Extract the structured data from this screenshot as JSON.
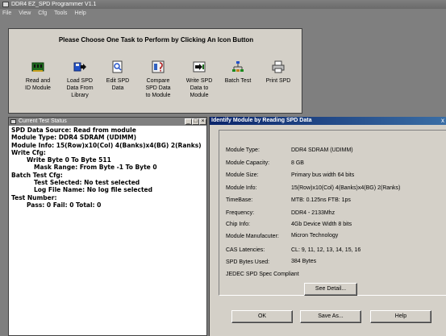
{
  "app": {
    "title": "DDR4 EZ_SPD Programmer V1.1",
    "menu": [
      "File",
      "View",
      "Cfg",
      "Tools",
      "Help"
    ]
  },
  "tasks": {
    "heading": "Please Choose One Task to Perform by Clicking An Icon Button",
    "items": [
      {
        "l1": "Read and",
        "l2": "ID Module",
        "l3": "",
        "icon": "memory-module-icon"
      },
      {
        "l1": "Load SPD",
        "l2": "Data From",
        "l3": "Library",
        "icon": "load-arrow-icon"
      },
      {
        "l1": "Edit SPD",
        "l2": "Data",
        "l3": "",
        "icon": "magnifier-icon"
      },
      {
        "l1": "Compare",
        "l2": "SPD Data",
        "l3": "to Module",
        "icon": "compare-icon"
      },
      {
        "l1": "Write SPD",
        "l2": "Data to",
        "l3": "Module",
        "icon": "write-arrow-icon"
      },
      {
        "l1": "Batch Test",
        "l2": "",
        "l3": "",
        "icon": "batch-network-icon"
      },
      {
        "l1": "Print SPD",
        "l2": "",
        "l3": "",
        "icon": "printer-icon"
      }
    ]
  },
  "status": {
    "title": "Current Test Status",
    "lines": [
      "SPD Data Source:  Read from module",
      "Module Type: DDR4 SDRAM (UDIMM)",
      "Module Info:  15(Row)x10(Col) 4(Banks)x4(BG) 2(Ranks)",
      "Write Cfg:",
      "Write Byte 0 To Byte 511",
      "Mask Range: From Byte -1 To Byte 0",
      "Batch Test Cfg:",
      "Test Selected:     No test selected",
      "Log File Name:    No log file selected",
      "Test Number:",
      "Pass: 0 Fail: 0 Total: 0"
    ]
  },
  "identify": {
    "title": "Identify Module by Reading SPD Data",
    "close": "x",
    "fields": [
      {
        "label": "Module Type:",
        "value": "DDR4 SDRAM (UDIMM)"
      },
      {
        "label": "Module Capacity:",
        "value": "8 GB"
      },
      {
        "label": "Module Size:",
        "value": "Primary bus width 64 bits"
      },
      {
        "label": "Module Info:",
        "value": "15(Row)x10(Col) 4(Banks)x4(BG) 2(Ranks)"
      },
      {
        "label": "TimeBase:",
        "value": "MTB: 0.125ns FTB: 1ps"
      },
      {
        "label": "Frequency:",
        "value": "DDR4 - 2133Mhz"
      },
      {
        "label": "Chip Info:",
        "value": "4Gb Device Width 8 bits"
      },
      {
        "label": "Module Manufacuter:",
        "value": "Micron Technology"
      },
      {
        "label": "CAS Latencies:",
        "value": "CL: 9, 11, 12, 13, 14, 15, 16"
      },
      {
        "label": "SPD Bytes Used:",
        "value": "384 Bytes"
      }
    ],
    "jedec": "JEDEC SPD Spec Compliant",
    "see_detail": "See Detail...",
    "ok": "OK",
    "save_as": "Save As...",
    "help": "Help"
  },
  "colors": {
    "desktop": "#7f7f7f",
    "panel": "#d4d0c8",
    "active_title_start": "#0a246a",
    "active_title_end": "#3a6ea5"
  }
}
